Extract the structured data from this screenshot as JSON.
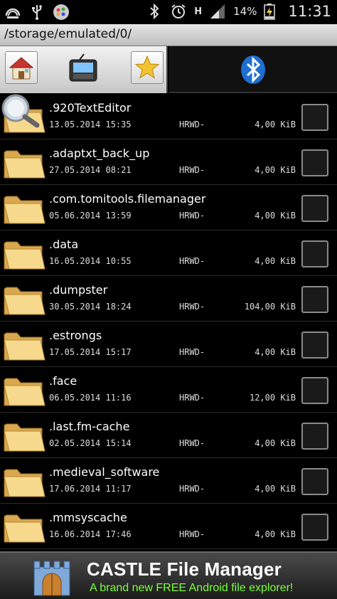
{
  "status_bar": {
    "battery_percent": "14%",
    "time": "11:31",
    "network_label": "H",
    "left_icons": [
      "gauge-icon",
      "usb-icon",
      "app-icon"
    ],
    "right_icons": [
      "bluetooth-icon",
      "alarm-icon",
      "signal-icon",
      "battery-charging-icon"
    ]
  },
  "path": "/storage/emulated/0/",
  "toolbar": {
    "left_buttons": [
      "home-icon",
      "device-icon",
      "star-icon"
    ],
    "right_tab": "bluetooth-icon"
  },
  "files": [
    {
      "name": ".920TextEditor",
      "date": "13.05.2014 15:35",
      "attr": "HRWD-",
      "size": "4,00 KiB"
    },
    {
      "name": ".adaptxt_back_up",
      "date": "27.05.2014 08:21",
      "attr": "HRWD-",
      "size": "4,00 KiB"
    },
    {
      "name": ".com.tomitools.filemanager",
      "date": "05.06.2014 13:59",
      "attr": "HRWD-",
      "size": "4,00 KiB"
    },
    {
      "name": ".data",
      "date": "16.05.2014 10:55",
      "attr": "HRWD-",
      "size": "4,00 KiB"
    },
    {
      "name": ".dumpster",
      "date": "30.05.2014 18:24",
      "attr": "HRWD-",
      "size": "104,00 KiB"
    },
    {
      "name": ".estrongs",
      "date": "17.05.2014 15:17",
      "attr": "HRWD-",
      "size": "4,00 KiB"
    },
    {
      "name": ".face",
      "date": "06.05.2014 11:16",
      "attr": "HRWD-",
      "size": "12,00 KiB"
    },
    {
      "name": ".last.fm-cache",
      "date": "02.05.2014 15:14",
      "attr": "HRWD-",
      "size": "4,00 KiB"
    },
    {
      "name": ".medieval_software",
      "date": "17.06.2014 11:17",
      "attr": "HRWD-",
      "size": "4,00 KiB"
    },
    {
      "name": ".mmsyscache",
      "date": "16.06.2014 17:46",
      "attr": "HRWD-",
      "size": "4,00 KiB"
    }
  ],
  "banner": {
    "title": "CASTLE File Manager",
    "subtitle": "A brand new FREE Android file explorer!",
    "subtitle_color": "#7cff3a"
  }
}
